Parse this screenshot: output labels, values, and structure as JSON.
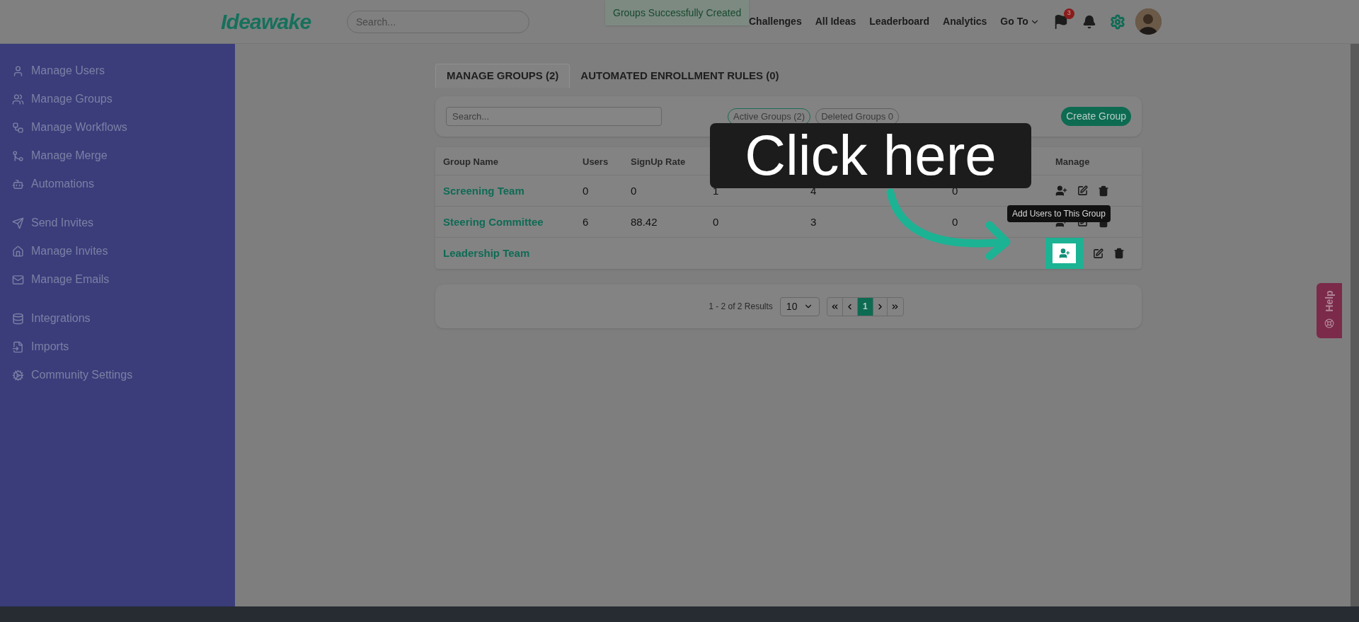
{
  "header": {
    "logo": "Ideawake",
    "search": {
      "placeholder": "Search..."
    },
    "toast": "Groups Successfully Created",
    "nav": [
      {
        "label": "Challenges",
        "kind": "link"
      },
      {
        "label": "All Ideas",
        "kind": "link"
      },
      {
        "label": "Leaderboard",
        "kind": "link"
      },
      {
        "label": "Analytics",
        "kind": "link"
      },
      {
        "label": "Go To",
        "kind": "dropdown"
      }
    ],
    "flag_badge": "3"
  },
  "sidebar": {
    "sections": [
      {
        "items": [
          "Manage Users",
          "Manage Groups",
          "Manage Workflows",
          "Manage Merge",
          "Automations"
        ]
      },
      {
        "items": [
          "Send Invites",
          "Manage Invites",
          "Manage Emails"
        ]
      },
      {
        "items": [
          "Integrations",
          "Imports",
          "Community Settings"
        ]
      }
    ]
  },
  "tabs": [
    {
      "label": "MANAGE GROUPS (2)",
      "selected": true
    },
    {
      "label": "AUTOMATED ENROLLMENT RULES (0)",
      "selected": false
    }
  ],
  "filter_bar": {
    "search": {
      "placeholder": "Search..."
    },
    "filters": [
      {
        "label": "Active Groups (2)",
        "selected": true
      },
      {
        "label": "Deleted Groups 0",
        "selected": false
      }
    ],
    "create_button": "Create Group"
  },
  "table": {
    "columns": [
      "Group Name",
      "Users",
      "SignUp Rate"
    ],
    "manage_column": "Manage",
    "rows": [
      {
        "cells": [
          "Screening Team",
          "0",
          "0",
          "1",
          "4",
          "0"
        ],
        "highlighted": false
      },
      {
        "cells": [
          "Steering Committee",
          "6",
          "88.42",
          "0",
          "3",
          "0"
        ],
        "highlighted": false
      },
      {
        "cells": [
          "Leadership Team"
        ],
        "highlighted": true
      }
    ]
  },
  "tooltip": "Add Users to This Group",
  "pagination": {
    "summary": "1 - 2 of 2 Results",
    "page_size": "10",
    "pages": [
      {
        "label": "1",
        "selected": true
      }
    ]
  },
  "callout": "Click here",
  "help": "Help"
}
